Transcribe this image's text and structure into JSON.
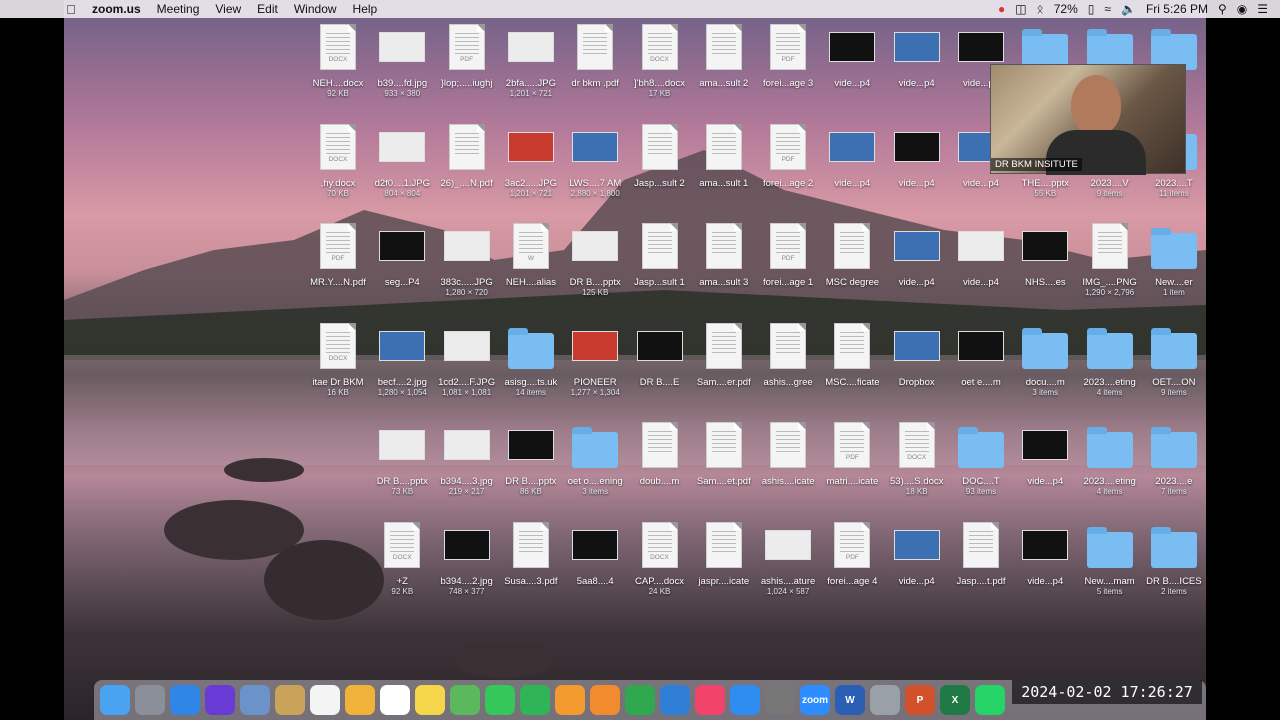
{
  "menubar": {
    "app_name": "zoom.us",
    "menus": [
      "Meeting",
      "View",
      "Edit",
      "Window",
      "Help"
    ],
    "battery": "72%",
    "datetime": "Fri 5:26 PM"
  },
  "video_tile": {
    "name": "DR BKM INSITUTE"
  },
  "clock": "2024-02-02  17:26:27",
  "files": [
    {
      "name": "NEH....docx",
      "sub": "92 KB",
      "kind": "doc",
      "tag": "DOCX"
    },
    {
      "name": "b39....fd.jpg",
      "sub": "933 × 380",
      "kind": "img",
      "tone": "light"
    },
    {
      "name": "}lop;.....iughj",
      "sub": "",
      "kind": "doc",
      "tag": "PDF"
    },
    {
      "name": "2bfa.....JPG",
      "sub": "1,201 × 721",
      "kind": "img",
      "tone": "light"
    },
    {
      "name": "dr bkm .pdf",
      "sub": "",
      "kind": "doc",
      "tag": ""
    },
    {
      "name": "]'bh8....docx",
      "sub": "17 KB",
      "kind": "doc",
      "tag": "DOCX"
    },
    {
      "name": "ama...sult 2",
      "sub": "",
      "kind": "doc",
      "tag": ""
    },
    {
      "name": "forei...age 3",
      "sub": "",
      "kind": "doc",
      "tag": "PDF"
    },
    {
      "name": "vide...p4",
      "sub": "",
      "kind": "img",
      "tone": "dark"
    },
    {
      "name": "vide...p4",
      "sub": "",
      "kind": "img",
      "tone": "blue"
    },
    {
      "name": "vide...p4",
      "sub": "",
      "kind": "img",
      "tone": "dark"
    },
    {
      "name": "",
      "sub": "",
      "kind": "folder"
    },
    {
      "name": "",
      "sub": "",
      "kind": "folder"
    },
    {
      "name": "",
      "sub": "",
      "kind": "folder"
    },
    {
      "name": ",hy.docx",
      "sub": "70 KB",
      "kind": "doc",
      "tag": "DOCX"
    },
    {
      "name": "d2f0....1.JPG",
      "sub": "804 × 804",
      "kind": "img",
      "tone": "light"
    },
    {
      "name": "26)_....N.pdf",
      "sub": "",
      "kind": "doc",
      "tag": ""
    },
    {
      "name": "3ac2.....JPG",
      "sub": "1,201 × 721",
      "kind": "img",
      "tone": "red"
    },
    {
      "name": "LWS....7 AM",
      "sub": "2,880 × 1,800",
      "kind": "img",
      "tone": "blue"
    },
    {
      "name": "Jasp...sult 2",
      "sub": "",
      "kind": "doc",
      "tag": ""
    },
    {
      "name": "ama...sult 1",
      "sub": "",
      "kind": "doc",
      "tag": ""
    },
    {
      "name": "forei...age 2",
      "sub": "",
      "kind": "doc",
      "tag": "PDF"
    },
    {
      "name": "vide...p4",
      "sub": "",
      "kind": "img",
      "tone": "blue"
    },
    {
      "name": "vide...p4",
      "sub": "",
      "kind": "img",
      "tone": "dark"
    },
    {
      "name": "vide...p4",
      "sub": "",
      "kind": "img",
      "tone": "blue"
    },
    {
      "name": "THE....pptx",
      "sub": "55 KB",
      "kind": "img",
      "tone": "light"
    },
    {
      "name": "2023....V",
      "sub": "9 items",
      "kind": "folder"
    },
    {
      "name": "2023....T",
      "sub": "11 items",
      "kind": "folder"
    },
    {
      "name": "MR.Y....N.pdf",
      "sub": "",
      "kind": "doc",
      "tag": "PDF"
    },
    {
      "name": "seg...P4",
      "sub": "",
      "kind": "img",
      "tone": "dark"
    },
    {
      "name": "383c.....JPG",
      "sub": "1,280 × 720",
      "kind": "img",
      "tone": "light"
    },
    {
      "name": "NEH....alias",
      "sub": "",
      "kind": "doc",
      "tag": "W"
    },
    {
      "name": "DR B....pptx",
      "sub": "125 KB",
      "kind": "img",
      "tone": "light"
    },
    {
      "name": "Jasp...sult 1",
      "sub": "",
      "kind": "doc",
      "tag": ""
    },
    {
      "name": "ama...sult 3",
      "sub": "",
      "kind": "doc",
      "tag": ""
    },
    {
      "name": "forei...age 1",
      "sub": "",
      "kind": "doc",
      "tag": "PDF"
    },
    {
      "name": "MSC degree",
      "sub": "",
      "kind": "doc",
      "tag": ""
    },
    {
      "name": "vide...p4",
      "sub": "",
      "kind": "img",
      "tone": "blue"
    },
    {
      "name": "vide...p4",
      "sub": "",
      "kind": "img",
      "tone": "light"
    },
    {
      "name": "NHS....es",
      "sub": "",
      "kind": "img",
      "tone": "dark"
    },
    {
      "name": "IMG_....PNG",
      "sub": "1,290 × 2,796",
      "kind": "doc",
      "tag": ""
    },
    {
      "name": "New....er",
      "sub": "1 item",
      "kind": "folder"
    },
    {
      "name": "itae Dr BKM",
      "sub": "16 KB",
      "kind": "doc",
      "tag": "DOCX"
    },
    {
      "name": "becf....2.jpg",
      "sub": "1,280 × 1,054",
      "kind": "img",
      "tone": "blue"
    },
    {
      "name": "1cd2....F.JPG",
      "sub": "1,081 × 1,081",
      "kind": "img",
      "tone": "light"
    },
    {
      "name": "asisg....ts.uk",
      "sub": "14 items",
      "kind": "folder"
    },
    {
      "name": "PIONEER",
      "sub": "1,277 × 1,304",
      "kind": "img",
      "tone": "red"
    },
    {
      "name": "DR B....E",
      "sub": "",
      "kind": "img",
      "tone": "dark"
    },
    {
      "name": "Sam....er.pdf",
      "sub": "",
      "kind": "doc",
      "tag": ""
    },
    {
      "name": "ashis...gree",
      "sub": "",
      "kind": "doc",
      "tag": ""
    },
    {
      "name": "MSC....ficate",
      "sub": "",
      "kind": "doc",
      "tag": ""
    },
    {
      "name": "Dropbox",
      "sub": "",
      "kind": "img",
      "tone": "blue"
    },
    {
      "name": "oet e....m",
      "sub": "",
      "kind": "img",
      "tone": "dark"
    },
    {
      "name": "docu....m",
      "sub": "3 items",
      "kind": "folder"
    },
    {
      "name": "2023....eting",
      "sub": "4 items",
      "kind": "folder"
    },
    {
      "name": "OET....ON",
      "sub": "9 items",
      "kind": "folder"
    },
    {
      "name": "",
      "sub": "",
      "kind": "none"
    },
    {
      "name": "DR B....pptx",
      "sub": "73 KB",
      "kind": "img",
      "tone": "light"
    },
    {
      "name": "b394....3.jpg",
      "sub": "219 × 217",
      "kind": "img",
      "tone": "light"
    },
    {
      "name": "DR B....pptx",
      "sub": "86 KB",
      "kind": "img",
      "tone": "dark"
    },
    {
      "name": "oet o....ening",
      "sub": "3 items",
      "kind": "folder"
    },
    {
      "name": "doub....m",
      "sub": "",
      "kind": "doc",
      "tag": ""
    },
    {
      "name": "Sam....et.pdf",
      "sub": "",
      "kind": "doc",
      "tag": ""
    },
    {
      "name": "ashis....icate",
      "sub": "",
      "kind": "doc",
      "tag": ""
    },
    {
      "name": "matri....icate",
      "sub": "",
      "kind": "doc",
      "tag": "PDF"
    },
    {
      "name": "53)....S.docx",
      "sub": "18 KB",
      "kind": "doc",
      "tag": "DOCX"
    },
    {
      "name": "DOC....T",
      "sub": "93 items",
      "kind": "folder"
    },
    {
      "name": "vide...p4",
      "sub": "",
      "kind": "img",
      "tone": "dark"
    },
    {
      "name": "2023....eting",
      "sub": "4 items",
      "kind": "folder"
    },
    {
      "name": "2023....e",
      "sub": "7 items",
      "kind": "folder"
    },
    {
      "name": "",
      "sub": "",
      "kind": "none"
    },
    {
      "name": "+Z",
      "sub": "92 KB",
      "kind": "doc",
      "tag": "DOCX"
    },
    {
      "name": "b394....2.jpg",
      "sub": "748 × 377",
      "kind": "img",
      "tone": "dark"
    },
    {
      "name": "Susa....3.pdf",
      "sub": "",
      "kind": "doc",
      "tag": ""
    },
    {
      "name": "5aa8....4",
      "sub": "",
      "kind": "img",
      "tone": "dark"
    },
    {
      "name": "CAP....docx",
      "sub": "24 KB",
      "kind": "doc",
      "tag": "DOCX"
    },
    {
      "name": "jaspr....icate",
      "sub": "",
      "kind": "doc",
      "tag": ""
    },
    {
      "name": "ashis....ature",
      "sub": "1,024 × 587",
      "kind": "img",
      "tone": "light"
    },
    {
      "name": "forei...age 4",
      "sub": "",
      "kind": "doc",
      "tag": "PDF"
    },
    {
      "name": "vide...p4",
      "sub": "",
      "kind": "img",
      "tone": "blue"
    },
    {
      "name": "Jasp....t.pdf",
      "sub": "",
      "kind": "doc",
      "tag": ""
    },
    {
      "name": "vide...p4",
      "sub": "",
      "kind": "img",
      "tone": "dark"
    },
    {
      "name": "New....mam",
      "sub": "5 items",
      "kind": "folder"
    },
    {
      "name": "DR B....ICES",
      "sub": "2 items",
      "kind": "folder"
    }
  ],
  "dock": [
    {
      "icon": "finder-icon",
      "color": "#4aa3f0"
    },
    {
      "icon": "launchpad-icon",
      "color": "#8a8f99"
    },
    {
      "icon": "safari-icon",
      "color": "#2f86e6"
    },
    {
      "icon": "siri-icon",
      "color": "#6a3ad6"
    },
    {
      "icon": "preview-icon",
      "color": "#6c93c9"
    },
    {
      "icon": "notes-folder-icon",
      "color": "#c9a35a"
    },
    {
      "icon": "calendar-icon",
      "color": "#f4f4f4"
    },
    {
      "icon": "photos-icon",
      "color": "#f0b33a"
    },
    {
      "icon": "reminders-icon",
      "color": "#ffffff"
    },
    {
      "icon": "notes-icon",
      "color": "#f5d64a"
    },
    {
      "icon": "maps-icon",
      "color": "#5cb85c"
    },
    {
      "icon": "messages-icon",
      "color": "#34c759"
    },
    {
      "icon": "facetime-icon",
      "color": "#2fb457"
    },
    {
      "icon": "pages-icon",
      "color": "#f29a2e"
    },
    {
      "icon": "books-icon",
      "color": "#f28b2e"
    },
    {
      "icon": "numbers-icon",
      "color": "#2fa84f"
    },
    {
      "icon": "keynote-icon",
      "color": "#2f7fd6"
    },
    {
      "icon": "music-icon",
      "color": "#f2436a"
    },
    {
      "icon": "app-store-icon",
      "color": "#2f8cf0"
    },
    {
      "icon": "settings-icon",
      "color": "#777777"
    },
    {
      "icon": "zoom-icon",
      "color": "#2d8cff",
      "label": "zoom"
    },
    {
      "icon": "word-icon",
      "color": "#2b5fb4",
      "label": "W"
    },
    {
      "icon": "screenshot-icon",
      "color": "#9aa0a8"
    },
    {
      "icon": "powerpoint-icon",
      "color": "#d2502a",
      "label": "P"
    },
    {
      "icon": "excel-icon",
      "color": "#1f7a45",
      "label": "X"
    },
    {
      "icon": "whatsapp-icon",
      "color": "#25d366"
    }
  ]
}
